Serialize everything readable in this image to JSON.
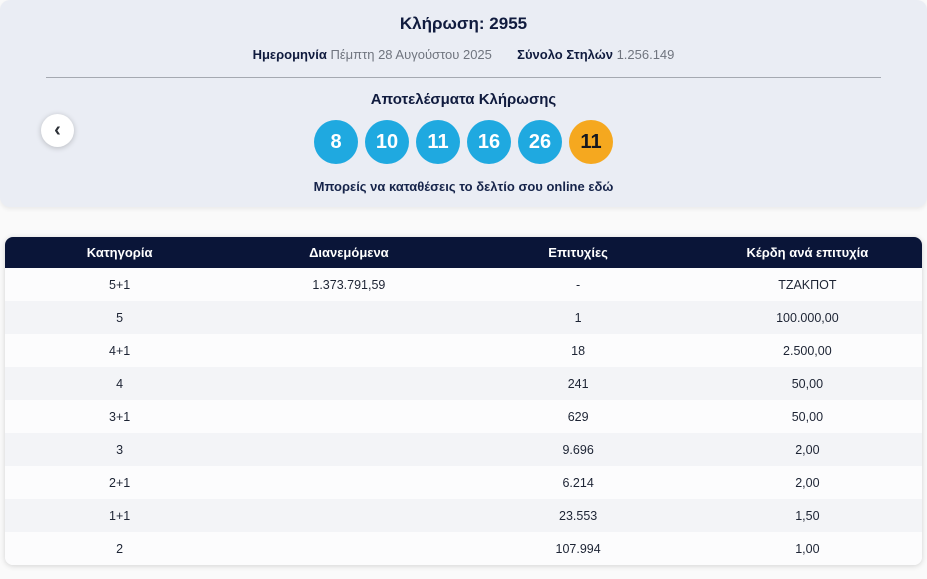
{
  "header": {
    "title": "Κλήρωση: 2955",
    "date_label": "Ημερομηνία",
    "date_value": "Πέμπτη 28 Αυγούστου 2025",
    "columns_label": "Σύνολο Στηλών",
    "columns_value": "1.256.149",
    "results_title": "Αποτελέσματα Κλήρωσης",
    "numbers": [
      "8",
      "10",
      "11",
      "16",
      "26"
    ],
    "joker_number": "11",
    "link_text": "Μπορείς να καταθέσεις το δελτίο σου online εδώ",
    "prev_icon": "‹"
  },
  "colors": {
    "panel_background": "#eaedf4",
    "ball_blue": "#1fa9e0",
    "ball_orange": "#f5a81f",
    "table_header_navy": "#0a1538"
  },
  "table": {
    "headers": [
      "Κατηγορία",
      "Διανεμόμενα",
      "Επιτυχίες",
      "Κέρδη ανά επιτυχία"
    ],
    "rows": [
      [
        "5+1",
        "1.373.791,59",
        "-",
        "ΤΖΑΚΠΟΤ"
      ],
      [
        "5",
        "",
        "1",
        "100.000,00"
      ],
      [
        "4+1",
        "",
        "18",
        "2.500,00"
      ],
      [
        "4",
        "",
        "241",
        "50,00"
      ],
      [
        "3+1",
        "",
        "629",
        "50,00"
      ],
      [
        "3",
        "",
        "9.696",
        "2,00"
      ],
      [
        "2+1",
        "",
        "6.214",
        "2,00"
      ],
      [
        "1+1",
        "",
        "23.553",
        "1,50"
      ],
      [
        "2",
        "",
        "107.994",
        "1,00"
      ]
    ]
  }
}
